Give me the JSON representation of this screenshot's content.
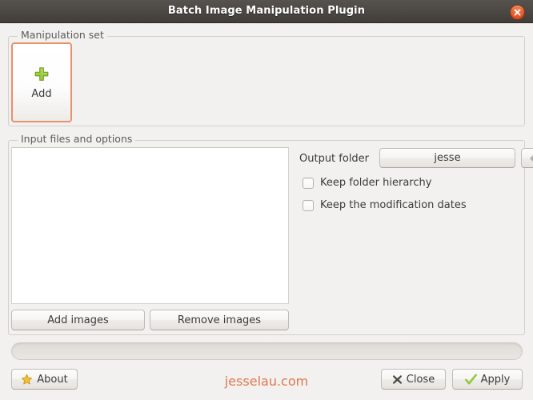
{
  "window": {
    "title": "Batch Image Manipulation Plugin",
    "close_icon": "close-icon",
    "titlebar_color": "#4c4945",
    "background_color": "#f2f1f0"
  },
  "manipulation_set": {
    "group_title": "Manipulation set",
    "add_card": {
      "label": "Add",
      "icon": "plus-icon",
      "icon_color": "#8ec63f",
      "border_color": "#e8916a"
    }
  },
  "input_files": {
    "group_title": "Input files and options",
    "file_list": {
      "items": []
    },
    "add_images_label": "Add images",
    "remove_images_label": "Remove images",
    "output_folder": {
      "label": "Output folder",
      "value": "jesse",
      "nav_icon": "chevron-left-icon"
    },
    "checkboxes": [
      {
        "label": "Keep folder hierarchy",
        "checked": false
      },
      {
        "label": "Keep the modification dates",
        "checked": false
      }
    ]
  },
  "progress": {
    "value": 0,
    "text": ""
  },
  "footer": {
    "about_label": "About",
    "about_icon": "star-icon",
    "close_label": "Close",
    "close_icon": "x-mark-icon",
    "apply_label": "Apply",
    "apply_icon": "check-icon",
    "watermark": "jesselau.com",
    "watermark_color": "#e2764d"
  }
}
